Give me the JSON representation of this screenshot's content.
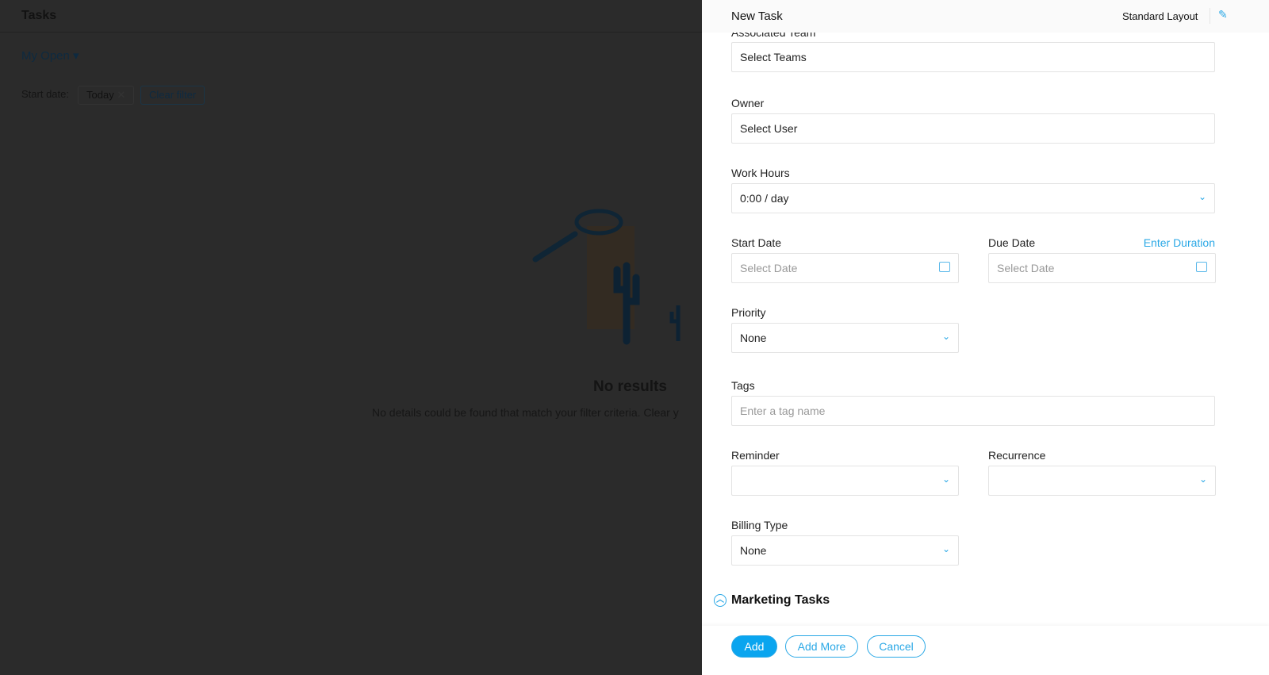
{
  "background": {
    "title": "Tasks",
    "view": "My Open",
    "filter_label": "Start date:",
    "filter_chip": "Today",
    "clear_filter": "Clear filter",
    "no_results": "No results",
    "no_results_desc": "No details could be found that match your filter criteria. Clear y"
  },
  "panel": {
    "title": "New Task",
    "layout": "Standard Layout",
    "fields": {
      "team_label": "Associated Team",
      "team_value": "Select Teams",
      "owner_label": "Owner",
      "owner_value": "Select User",
      "hours_label": "Work Hours",
      "hours_value": "0:00 / day",
      "start_label": "Start Date",
      "start_ph": "Select Date",
      "due_label": "Due Date",
      "due_ph": "Select Date",
      "enter_duration": "Enter Duration",
      "priority_label": "Priority",
      "priority_value": "None",
      "tags_label": "Tags",
      "tags_ph": "Enter a tag name",
      "reminder_label": "Reminder",
      "recurrence_label": "Recurrence",
      "billing_label": "Billing Type",
      "billing_value": "None"
    },
    "section": "Marketing Tasks",
    "buttons": {
      "add": "Add",
      "add_more": "Add More",
      "cancel": "Cancel"
    }
  },
  "colors": {
    "accent": "#0aa5ef",
    "overlay": "#2b2b2b"
  }
}
